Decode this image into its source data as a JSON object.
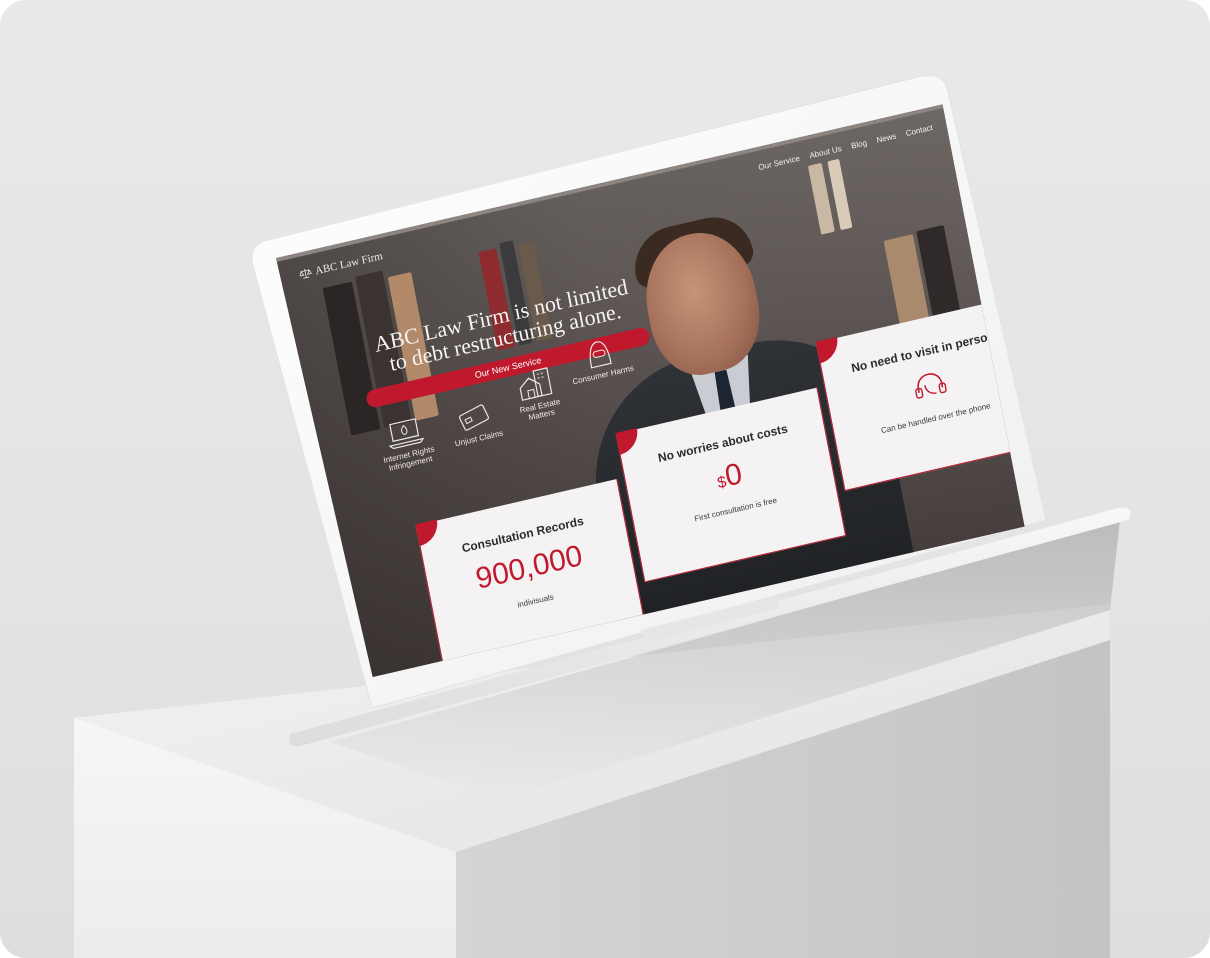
{
  "site": {
    "logo_text": "ABC Law Firm",
    "nav": [
      "Our Service",
      "About Us",
      "Blog",
      "News",
      "Contact"
    ],
    "headline_line1": "ABC Law Firm is not limited",
    "headline_line2": "to debt restructuring alone.",
    "cta_label": "Our New Service",
    "services": [
      {
        "label": "Internet Rights Infringement",
        "icon": "laptop-fire-icon"
      },
      {
        "label": "Unjust Claims",
        "icon": "credit-card-icon"
      },
      {
        "label": "Real Estate Matters",
        "icon": "house-building-icon"
      },
      {
        "label": "Consumer Harms",
        "icon": "hooded-person-icon"
      }
    ],
    "cards": [
      {
        "title": "Consultation Records",
        "value": "900,000",
        "sub": "indivisuals"
      },
      {
        "title": "No worries about costs",
        "currency": "$",
        "value": "0",
        "sub": "First consultation is free"
      },
      {
        "title": "No need to visit in person",
        "icon": "headset-icon",
        "sub": "Can be handled over the phone"
      }
    ]
  },
  "colors": {
    "accent": "#c0192e",
    "card_bg": "#f4f2f2",
    "background": "#e6e6e6"
  }
}
